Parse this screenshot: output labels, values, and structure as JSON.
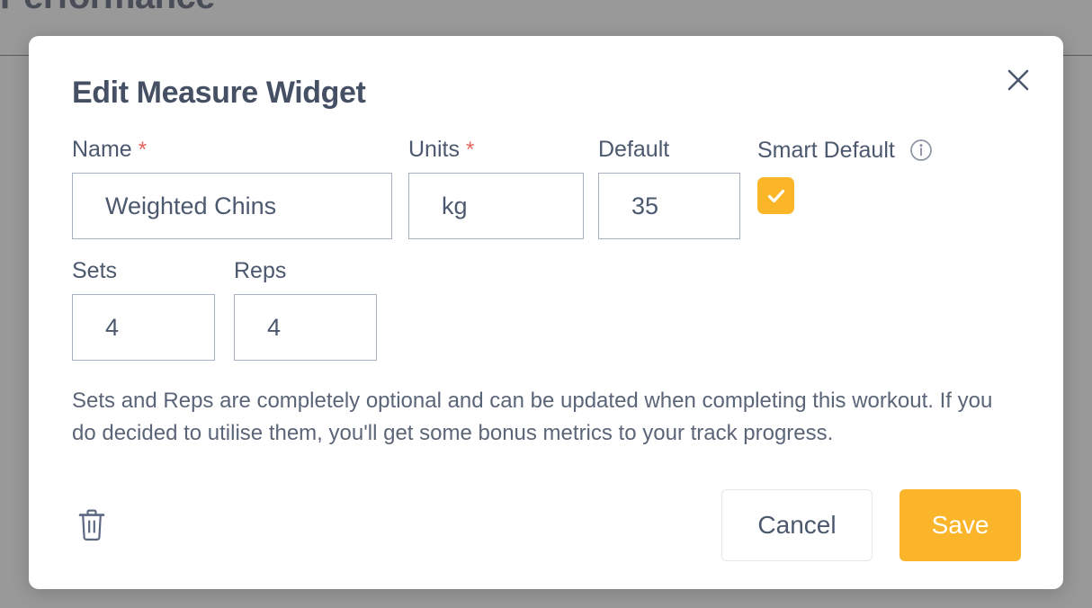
{
  "background": {
    "heading": "Performance"
  },
  "modal": {
    "title": "Edit Measure Widget",
    "close_icon": "close-icon",
    "fields": {
      "name": {
        "label": "Name",
        "required_marker": "*",
        "value": "Weighted Chins",
        "placeholder": ""
      },
      "units": {
        "label": "Units",
        "required_marker": "*",
        "value": "kg",
        "placeholder": ""
      },
      "default": {
        "label": "Default",
        "value": "35",
        "placeholder": ""
      },
      "smart_default": {
        "label": "Smart Default",
        "info_icon": "info-icon",
        "checked": true,
        "check_icon": "check-icon",
        "color": "#fab627"
      },
      "sets": {
        "label": "Sets",
        "value": "4",
        "placeholder": ""
      },
      "reps": {
        "label": "Reps",
        "value": "4",
        "placeholder": ""
      }
    },
    "help_text": "Sets and Reps are completely optional and can be updated when completing this workout. If you do decided to utilise them, you'll get some bonus metrics to your track progress.",
    "footer": {
      "delete_icon": "trash-icon",
      "cancel_label": "Cancel",
      "save_label": "Save",
      "save_color": "#fbb52b"
    }
  }
}
